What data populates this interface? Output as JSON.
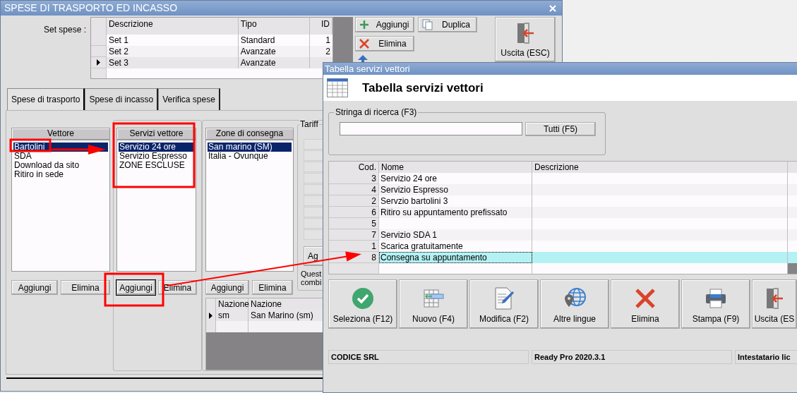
{
  "main_window": {
    "title": "SPESE DI TRASPORTO ED INCASSO",
    "set_spese": {
      "label": "Set spese :",
      "columns": [
        "Descrizione",
        "Tipo",
        "ID"
      ],
      "rows": [
        {
          "descrizione": "Set 1",
          "tipo": "Standard",
          "id": "1",
          "selected": false
        },
        {
          "descrizione": "Set 2",
          "tipo": "Avanzate",
          "id": "2",
          "selected": false
        },
        {
          "descrizione": "Set 3",
          "tipo": "Avanzate",
          "id": "",
          "selected": true
        }
      ]
    },
    "set_buttons": [
      {
        "label": "Aggiungi",
        "kind": "add"
      },
      {
        "label": "Duplica",
        "kind": "copy"
      },
      {
        "label": "Elimina",
        "kind": "delete"
      }
    ],
    "exit_button": "Uscita (ESC)",
    "tabs": [
      {
        "label": "Spese di trasporto",
        "selected": true
      },
      {
        "label": "Spese di incasso",
        "selected": false
      },
      {
        "label": "Verifica spese",
        "selected": false
      }
    ],
    "lists": [
      {
        "header": "Vettore",
        "items": [
          {
            "label": "Bartolini",
            "selected": true
          },
          {
            "label": "SDA",
            "selected": false
          },
          {
            "label": "Download da sito",
            "selected": false
          },
          {
            "label": "Ritiro in sede",
            "selected": false
          }
        ],
        "buttons": [
          {
            "label": "Aggiungi",
            "focused": false
          },
          {
            "label": "Elimina",
            "focused": false
          }
        ]
      },
      {
        "header": "Servizi vettore",
        "items": [
          {
            "label": "Servizio 24 ore",
            "selected": true
          },
          {
            "label": "Servizio Espresso",
            "selected": false
          },
          {
            "label": "ZONE ESCLUSE",
            "selected": false
          }
        ],
        "buttons": [
          {
            "label": "Aggiungi",
            "focused": true
          },
          {
            "label": "Elimina",
            "focused": false
          }
        ]
      },
      {
        "header": "Zone di consegna",
        "items": [
          {
            "label": "San marino (SM)",
            "selected": true
          },
          {
            "label": "Italia - Ovunque",
            "selected": false
          }
        ],
        "buttons": [
          {
            "label": "Aggiungi",
            "focused": false
          },
          {
            "label": "Elimina",
            "focused": false
          }
        ]
      }
    ],
    "tariffe": {
      "label": "Tariff",
      "button": "Ag",
      "note": [
        "Quest",
        "combi"
      ]
    },
    "nazioni": {
      "columns": [
        "Nazione",
        "Nazione"
      ],
      "rows": [
        {
          "code": "sm",
          "name": "San Marino (sm)",
          "selected": true
        }
      ]
    }
  },
  "dialog": {
    "title": "Tabella servizi vettori",
    "heading": "Tabella servizi vettori",
    "search": {
      "label": "Stringa di ricerca (F3)",
      "button": "Tutti (F5)"
    },
    "table": {
      "columns": [
        "Cod.",
        "Nome",
        "Descrizione"
      ],
      "rows": [
        {
          "cod": "3",
          "nome": "Servizio 24 ore",
          "selected": false
        },
        {
          "cod": "4",
          "nome": "Servizio Espresso",
          "selected": false
        },
        {
          "cod": "2",
          "nome": "Servzio bartolini 3",
          "selected": false
        },
        {
          "cod": "6",
          "nome": "Ritiro su appuntamento prefissato",
          "selected": false
        },
        {
          "cod": "5",
          "nome": "",
          "selected": false
        },
        {
          "cod": "7",
          "nome": "Servizio SDA 1",
          "selected": false
        },
        {
          "cod": "1",
          "nome": "Scarica gratuitamente",
          "selected": false
        },
        {
          "cod": "8",
          "nome": "Consegna su appuntamento",
          "selected": true
        }
      ]
    },
    "toolbar": [
      {
        "label": "Seleziona (F12)",
        "kind": "select"
      },
      {
        "label": "Nuovo (F4)",
        "kind": "new"
      },
      {
        "label": "Modifica (F2)",
        "kind": "edit"
      },
      {
        "label": "Altre lingue",
        "kind": "languages"
      },
      {
        "label": "Elimina",
        "kind": "delete"
      },
      {
        "label": "Stampa (F9)",
        "kind": "print"
      },
      {
        "label": "Uscita (ES",
        "kind": "exit"
      }
    ],
    "status_bar": [
      "CODICE SRL",
      "Ready Pro 2020.3.1",
      "Intestatario lic"
    ]
  }
}
